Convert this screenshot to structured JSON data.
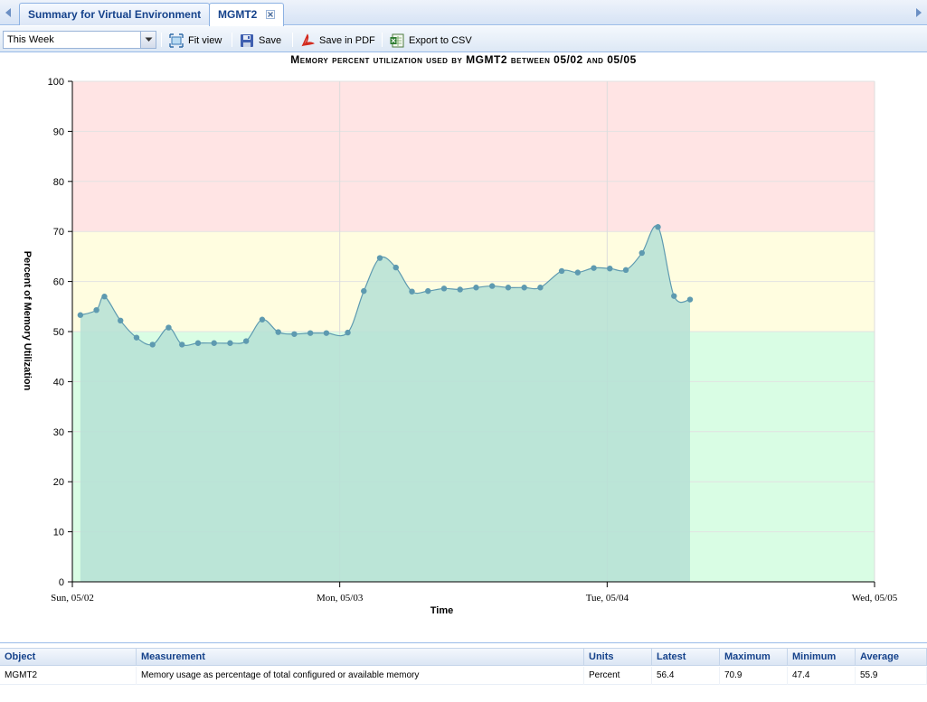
{
  "tabs": [
    {
      "label": "Summary for Virtual Environment",
      "active": false
    },
    {
      "label": "MGMT2",
      "active": true,
      "closable": true
    }
  ],
  "toolbar": {
    "period_value": "This Week",
    "fit_view_label": "Fit view",
    "save_label": "Save",
    "save_pdf_label": "Save in PDF",
    "export_csv_label": "Export to CSV"
  },
  "colors": {
    "zone_red": "#ffe4e4",
    "zone_yellow": "#fffde0",
    "zone_green": "#d9fde4",
    "area_fill": "#b5e0d5",
    "line": "#5e9ab0",
    "point": "#5e9ab0"
  },
  "chart_data": {
    "type": "area",
    "title": "Memory percent utilization used by MGMT2 between 05/02 and 05/05",
    "xlabel": "Time",
    "ylabel": "Percent of Memory Utilization",
    "ylim": [
      0,
      100
    ],
    "yticks": [
      0,
      10,
      20,
      30,
      40,
      50,
      60,
      70,
      80,
      90,
      100
    ],
    "xlim_days": [
      0,
      3
    ],
    "xticks": [
      {
        "day": 0,
        "label": "Sun, 05/02"
      },
      {
        "day": 1,
        "label": "Mon, 05/03"
      },
      {
        "day": 2,
        "label": "Tue, 05/04"
      },
      {
        "day": 3,
        "label": "Wed, 05/05"
      }
    ],
    "threshold_zones": [
      {
        "from": 0,
        "to": 50,
        "level": "normal"
      },
      {
        "from": 50,
        "to": 70,
        "level": "warning"
      },
      {
        "from": 70,
        "to": 100,
        "level": "critical"
      }
    ],
    "grid": true,
    "series": [
      {
        "name": "MGMT2",
        "points": [
          [
            0.03,
            53.3
          ],
          [
            0.09,
            54.3
          ],
          [
            0.12,
            57.0
          ],
          [
            0.18,
            52.2
          ],
          [
            0.24,
            48.8
          ],
          [
            0.3,
            47.4
          ],
          [
            0.36,
            50.8
          ],
          [
            0.41,
            47.4
          ],
          [
            0.47,
            47.7
          ],
          [
            0.53,
            47.7
          ],
          [
            0.59,
            47.7
          ],
          [
            0.65,
            48.1
          ],
          [
            0.71,
            52.4
          ],
          [
            0.77,
            49.9
          ],
          [
            0.83,
            49.5
          ],
          [
            0.89,
            49.7
          ],
          [
            0.95,
            49.7
          ],
          [
            1.03,
            49.8
          ],
          [
            1.09,
            58.1
          ],
          [
            1.15,
            64.7
          ],
          [
            1.21,
            62.8
          ],
          [
            1.27,
            58.0
          ],
          [
            1.33,
            58.1
          ],
          [
            1.39,
            58.6
          ],
          [
            1.45,
            58.4
          ],
          [
            1.51,
            58.8
          ],
          [
            1.57,
            59.1
          ],
          [
            1.63,
            58.8
          ],
          [
            1.69,
            58.8
          ],
          [
            1.75,
            58.8
          ],
          [
            1.83,
            62.1
          ],
          [
            1.89,
            61.8
          ],
          [
            1.95,
            62.7
          ],
          [
            2.01,
            62.6
          ],
          [
            2.07,
            62.3
          ],
          [
            2.13,
            65.7
          ],
          [
            2.19,
            70.9
          ],
          [
            2.25,
            57.1
          ],
          [
            2.31,
            56.4
          ]
        ]
      }
    ]
  },
  "grid": {
    "columns": [
      "Object",
      "Measurement",
      "Units",
      "Latest",
      "Maximum",
      "Minimum",
      "Average"
    ],
    "rows": [
      {
        "object": "MGMT2",
        "measurement": "Memory usage as percentage of total configured or available memory",
        "units": "Percent",
        "latest": "56.4",
        "maximum": "70.9",
        "minimum": "47.4",
        "average": "55.9"
      }
    ]
  }
}
